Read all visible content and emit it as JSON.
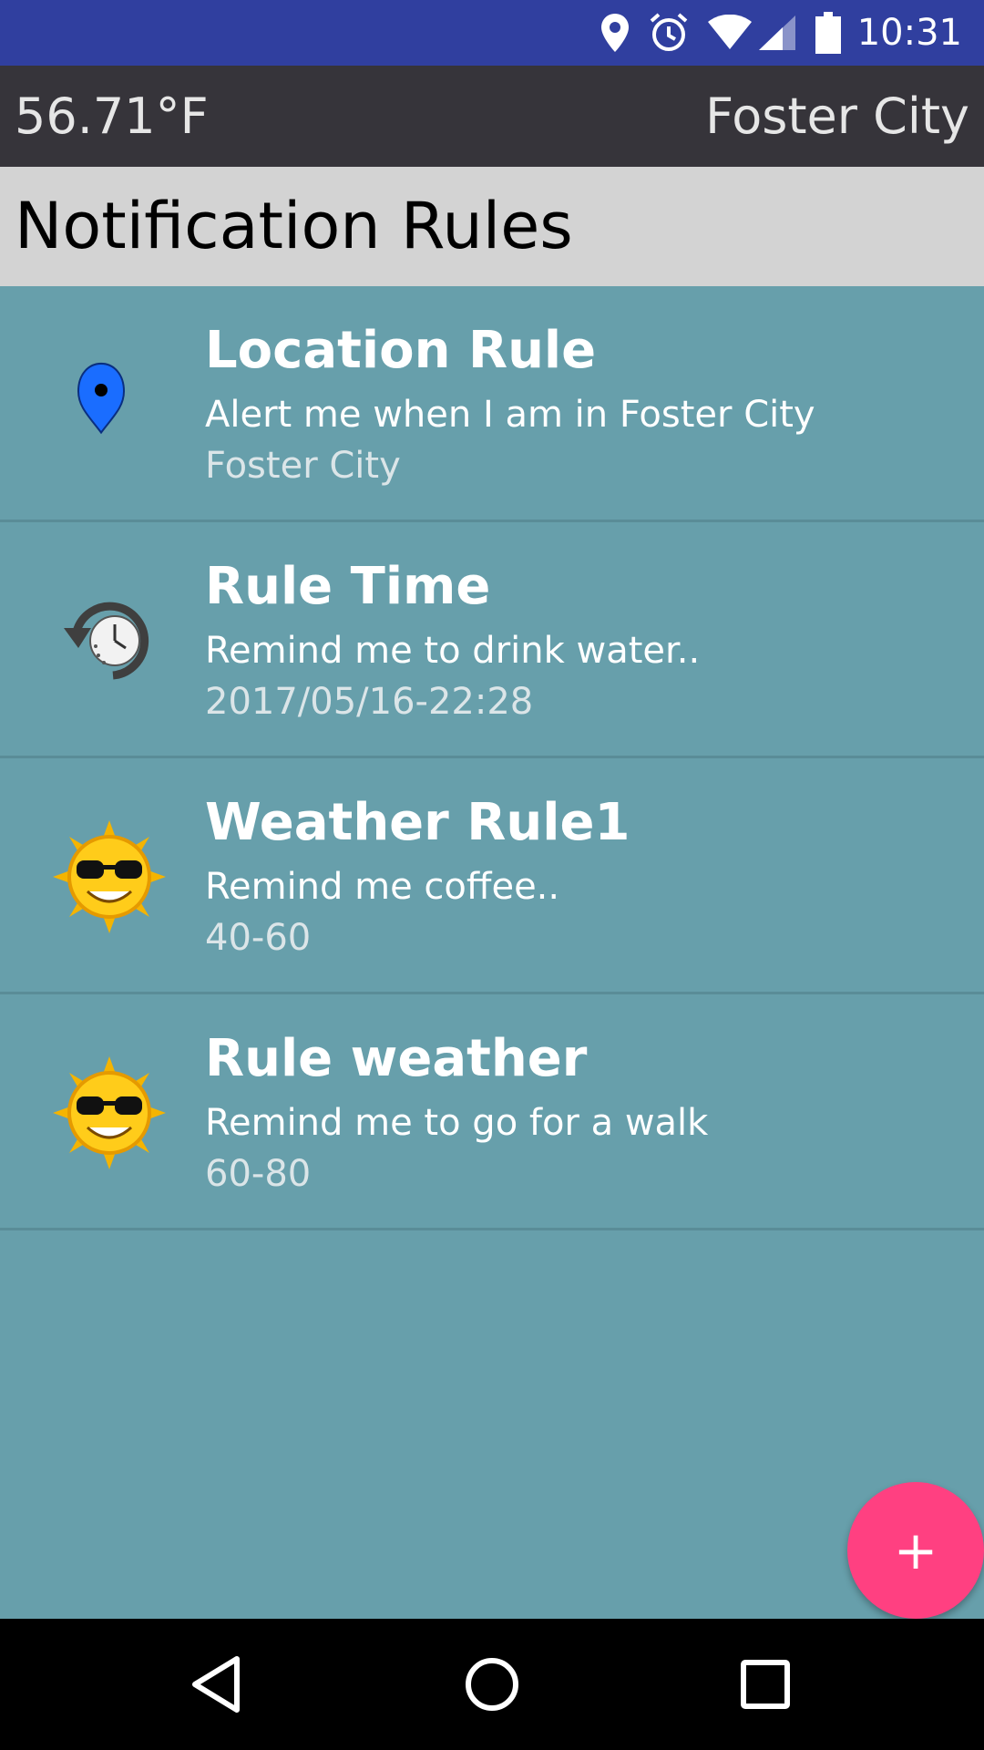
{
  "status_bar": {
    "time": "10:31",
    "icons": [
      "location-icon",
      "alarm-icon",
      "wifi-icon",
      "signal-icon",
      "battery-icon"
    ]
  },
  "weather_bar": {
    "temperature": "56.71°F",
    "city": "Foster City"
  },
  "page": {
    "title": "Notification Rules"
  },
  "rules": [
    {
      "name": "Location Rule",
      "description": "Alert me when I am in Foster City",
      "detail": "Foster City",
      "icon": "map-pin-icon"
    },
    {
      "name": "Rule Time",
      "description": "Remind me to drink water..",
      "detail": "2017/05/16-22:28",
      "icon": "clock-history-icon"
    },
    {
      "name": "Weather Rule1",
      "description": "Remind me coffee..",
      "detail": "40-60",
      "icon": "sun-sunglasses-icon"
    },
    {
      "name": "Rule weather",
      "description": "Remind me to go for a walk",
      "detail": "60-80",
      "icon": "sun-sunglasses-icon"
    }
  ],
  "fab": {
    "label": "+"
  },
  "nav": {
    "icons": [
      "back-icon",
      "home-icon",
      "recents-icon"
    ]
  },
  "colors": {
    "status_bar": "#303f9f",
    "weather_bar": "#36343a",
    "title_bar": "#d3d3d3",
    "list_background": "#679fab",
    "fab": "#ff4081"
  }
}
